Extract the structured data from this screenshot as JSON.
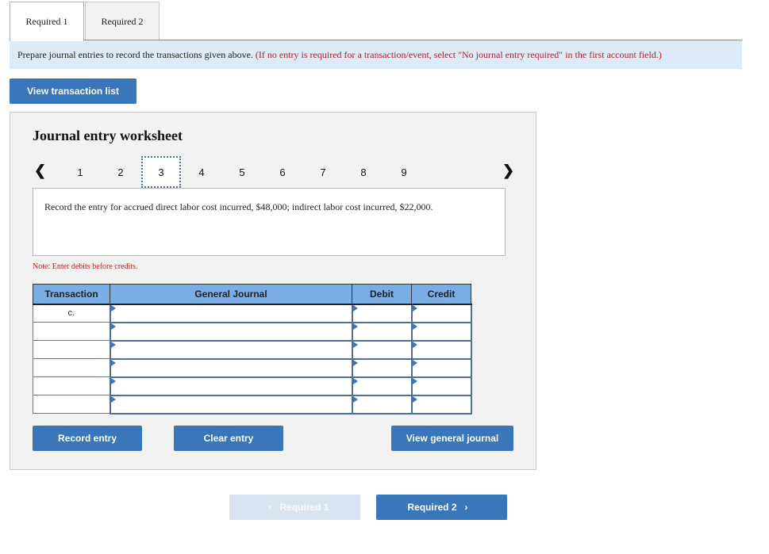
{
  "tabs": [
    {
      "label": "Required 1",
      "active": true
    },
    {
      "label": "Required 2",
      "active": false
    }
  ],
  "instruction": {
    "main": "Prepare journal entries to record the transactions given above.",
    "note": "(If no entry is required for a transaction/event, select \"No journal entry required\" in the first account field.)"
  },
  "view_transaction_list_label": "View transaction list",
  "worksheet": {
    "title": "Journal entry worksheet",
    "pager": {
      "prev_icon": "chevron-left-icon",
      "next_icon": "chevron-right-icon",
      "pages": [
        "1",
        "2",
        "3",
        "4",
        "5",
        "6",
        "7",
        "8",
        "9"
      ],
      "current": "3"
    },
    "prompt": "Record the entry for accrued direct labor cost incurred, $48,000; indirect labor cost incurred, $22,000.",
    "note": "Note: Enter debits before credits.",
    "table": {
      "headers": [
        "Transaction",
        "General Journal",
        "Debit",
        "Credit"
      ],
      "rows": [
        {
          "transaction": "c.",
          "account": "",
          "debit": "",
          "credit": ""
        },
        {
          "transaction": "",
          "account": "",
          "debit": "",
          "credit": ""
        },
        {
          "transaction": "",
          "account": "",
          "debit": "",
          "credit": ""
        },
        {
          "transaction": "",
          "account": "",
          "debit": "",
          "credit": ""
        },
        {
          "transaction": "",
          "account": "",
          "debit": "",
          "credit": ""
        },
        {
          "transaction": "",
          "account": "",
          "debit": "",
          "credit": ""
        }
      ]
    },
    "buttons": {
      "record": "Record entry",
      "clear": "Clear entry",
      "view_general_journal": "View general journal"
    }
  },
  "footer_nav": {
    "prev_label": "Required 1",
    "next_label": "Required 2"
  },
  "colors": {
    "accent": "#3a76ba",
    "table_header": "#7aade4",
    "instruction_bg": "#dcebf7",
    "warning_text": "#b4222a"
  }
}
